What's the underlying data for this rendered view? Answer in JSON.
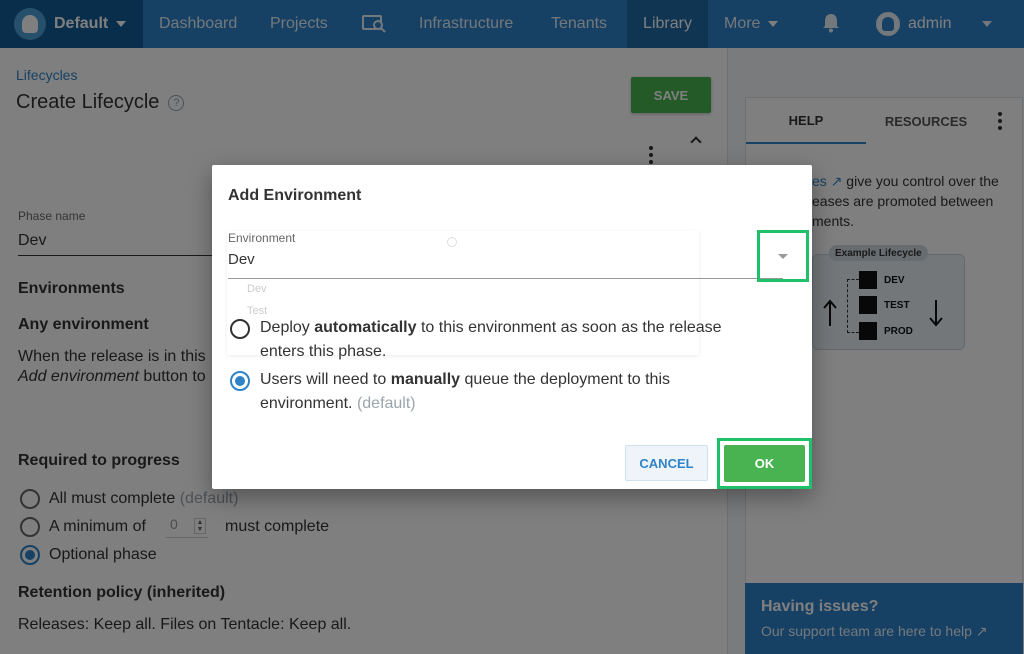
{
  "nav": {
    "space": "Default",
    "items": [
      "Dashboard",
      "Projects",
      "Infrastructure",
      "Tenants",
      "Library",
      "More"
    ],
    "user": "admin"
  },
  "page": {
    "breadcrumb": "Lifecycles",
    "title": "Create Lifecycle",
    "save": "SAVE",
    "phase_name_label": "Phase name",
    "phase_name_value": "Dev",
    "environments_heading": "Environments",
    "any_env_heading": "Any environment",
    "any_env_line1": "When the release is in this",
    "any_env_line2_italic": "Add environment",
    "any_env_line2_rest": " button to",
    "required_heading": "Required to progress",
    "opt_all": "All must complete",
    "opt_all_default": "(default)",
    "opt_min_prefix": "A minimum of",
    "opt_min_value": "0",
    "opt_min_suffix": "must complete",
    "opt_optional": "Optional phase",
    "retention_heading": "Retention policy (inherited)",
    "retention_text": "Releases: Keep all. Files on Tentacle: Keep all."
  },
  "side": {
    "tab_help": "HELP",
    "tab_resources": "RESOURCES",
    "help_link": "es",
    "help_line1": " give you control over the",
    "help_line2": "eases are promoted between",
    "help_line3": "ments.",
    "example_title": "Example Lifecycle",
    "stages": [
      "DEV",
      "TEST",
      "PROD"
    ],
    "issues_title": "Having issues?",
    "issues_sub": "Our support team are here to help"
  },
  "modal": {
    "title": "Add Environment",
    "env_label": "Environment",
    "env_value": "Dev",
    "ghost_items": [
      "Dev",
      "Test"
    ],
    "opt_auto_a": "Deploy ",
    "opt_auto_b": "automatically",
    "opt_auto_c": " to this environment as soon as the release enters this phase.",
    "opt_manual_a": "Users will need to ",
    "opt_manual_b": "manually",
    "opt_manual_c": " queue the deployment to this environment. ",
    "opt_manual_default": "(default)",
    "cancel": "CANCEL",
    "ok": "OK"
  },
  "colors": {
    "nav": "#2f83c8",
    "nav_dark": "#135d96",
    "primary_green": "#48b350",
    "highlight": "#1ec06a"
  },
  "icons": [
    "octopus-logo-icon",
    "caret-down-icon",
    "search-machines-icon",
    "bell-icon",
    "user-avatar-icon",
    "help-circle-icon",
    "kebab-menu-icon",
    "chevron-up-icon",
    "external-link-icon",
    "dropdown-arrow-icon"
  ]
}
